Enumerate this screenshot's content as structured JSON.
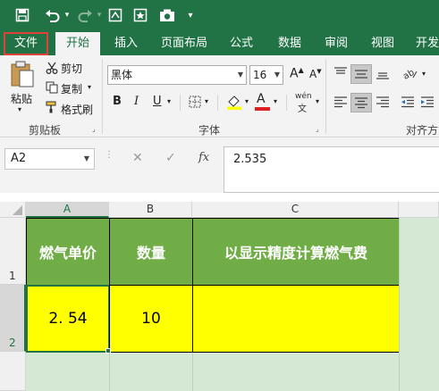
{
  "tabs": [
    {
      "label": "文件"
    },
    {
      "label": "开始"
    },
    {
      "label": "插入"
    },
    {
      "label": "页面布局"
    },
    {
      "label": "公式"
    },
    {
      "label": "数据"
    },
    {
      "label": "审阅"
    },
    {
      "label": "视图"
    },
    {
      "label": "开发"
    }
  ],
  "clipboard": {
    "paste": "粘贴",
    "cut": "剪切",
    "copy": "复制",
    "format_painter": "格式刷",
    "group_label": "剪贴板"
  },
  "font": {
    "family": "黑体",
    "size": "16",
    "bold": "B",
    "italic": "I",
    "underline": "U",
    "grow": "A",
    "shrink": "A",
    "font_color": "A",
    "phonetic": "wén",
    "group_label": "字体"
  },
  "alignment": {
    "group_label": "对齐方式"
  },
  "formula_bar": {
    "name_box": "A2",
    "fx": "fx",
    "formula": "2.535"
  },
  "columns": [
    "A",
    "B",
    "C"
  ],
  "rows": [
    "1",
    "2"
  ],
  "cells": {
    "A1": "燃气单价",
    "B1": "数量",
    "C1": "以显示精度计算燃气费",
    "A2": "2. 54",
    "B2": "10",
    "C2": ""
  },
  "colors": {
    "ribbon_green": "#217346",
    "header_fill": "#70ad47",
    "data_fill": "#ffff00",
    "empty_fill": "#d5e8d4"
  }
}
